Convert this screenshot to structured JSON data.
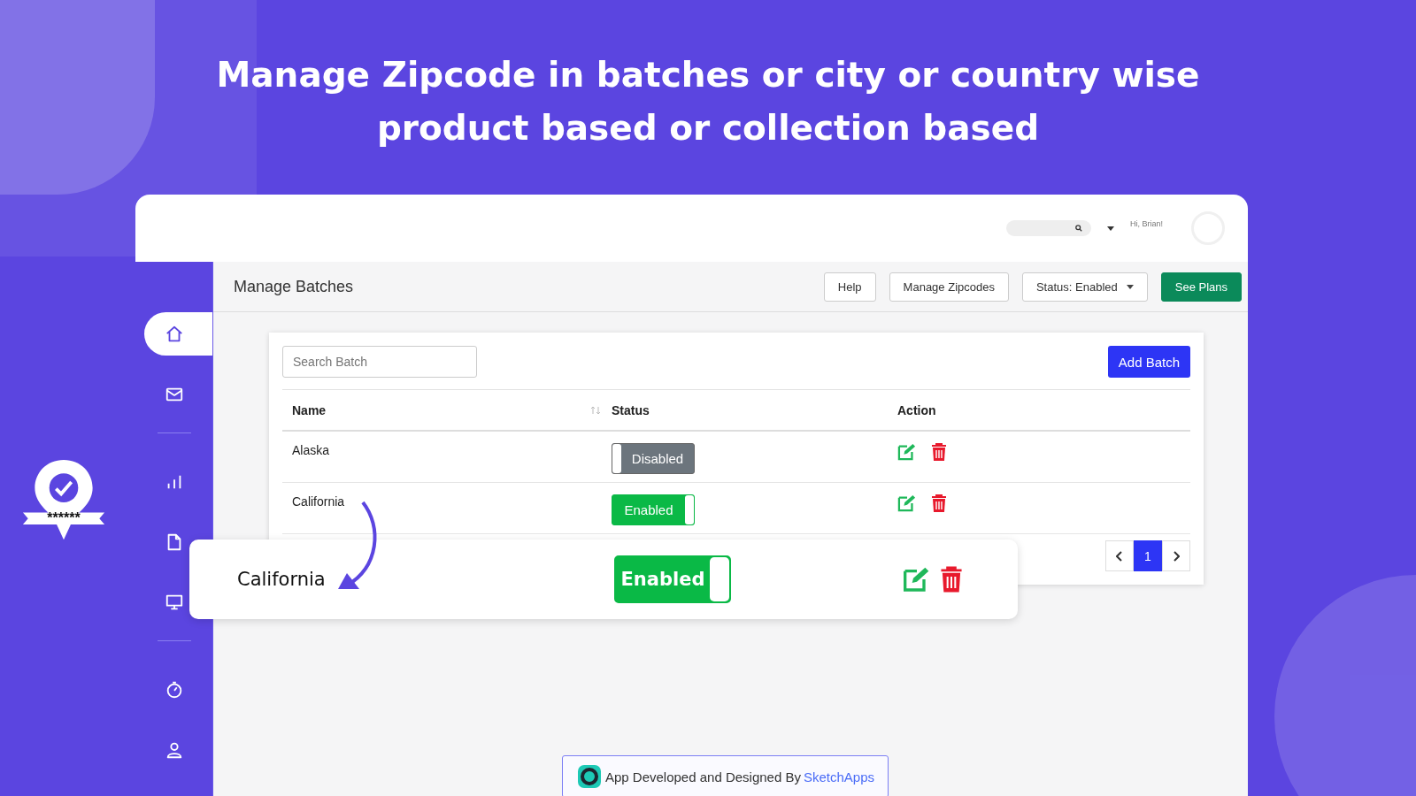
{
  "headline": [
    "Manage Zipcode in batches or city or country wise",
    "product based or collection based"
  ],
  "badge": {
    "text": "******"
  },
  "header": {
    "greeting": "Hi, Brian!"
  },
  "sidebar": {
    "items": [
      {
        "selected": true
      },
      {
        "selected": false
      },
      {
        "selected": false
      },
      {
        "selected": false
      },
      {
        "selected": false
      },
      {
        "selected": false
      },
      {
        "selected": false
      }
    ]
  },
  "page": {
    "title": "Manage Batches",
    "buttons": [
      {
        "label": "Help",
        "kind": "default"
      },
      {
        "label": "Manage Zipcodes",
        "kind": "default"
      },
      {
        "label": "Status: Enabled",
        "kind": "dropdown"
      },
      {
        "label": "See Plans",
        "kind": "primary"
      }
    ]
  },
  "card": {
    "search": {
      "placeholder": "Search Batch"
    },
    "add_button": "Add Batch",
    "columns": [
      "Name",
      "Status",
      "Action"
    ],
    "rows": [
      {
        "name": "Alaska",
        "status": "Disabled",
        "enabled": false
      },
      {
        "name": "California",
        "status": "Enabled",
        "enabled": true
      }
    ],
    "pagination": {
      "pages": [
        {
          "label": "1",
          "selected": true
        }
      ]
    }
  },
  "callout": {
    "name": "California",
    "status": "Enabled",
    "enabled": true
  },
  "footer": {
    "text": "App Developed and Designed By",
    "link": "SketchApps"
  }
}
